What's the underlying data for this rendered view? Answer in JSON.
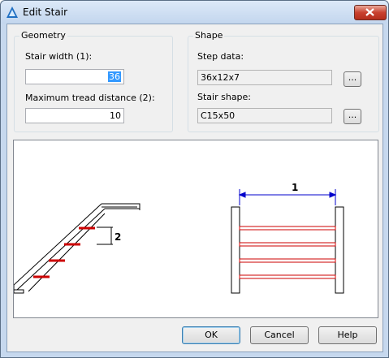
{
  "window": {
    "title": "Edit Stair",
    "close_label": "✕"
  },
  "geometry": {
    "group_label": "Geometry",
    "stair_width_label": "Stair width (1):",
    "stair_width_value": "36",
    "max_tread_label": "Maximum tread distance (2):",
    "max_tread_value": "10"
  },
  "shape": {
    "group_label": "Shape",
    "step_data_label": "Step data:",
    "step_data_value": "36x12x7",
    "stair_shape_label": "Stair shape:",
    "stair_shape_value": "C15x50",
    "browse_label": "..."
  },
  "preview": {
    "side_dimension": "2",
    "plan_dimension": "1"
  },
  "buttons": {
    "ok": "OK",
    "cancel": "Cancel",
    "help": "Help"
  },
  "colors": {
    "tread_red": "#cc0000",
    "dimension_blue": "#0000cc"
  }
}
